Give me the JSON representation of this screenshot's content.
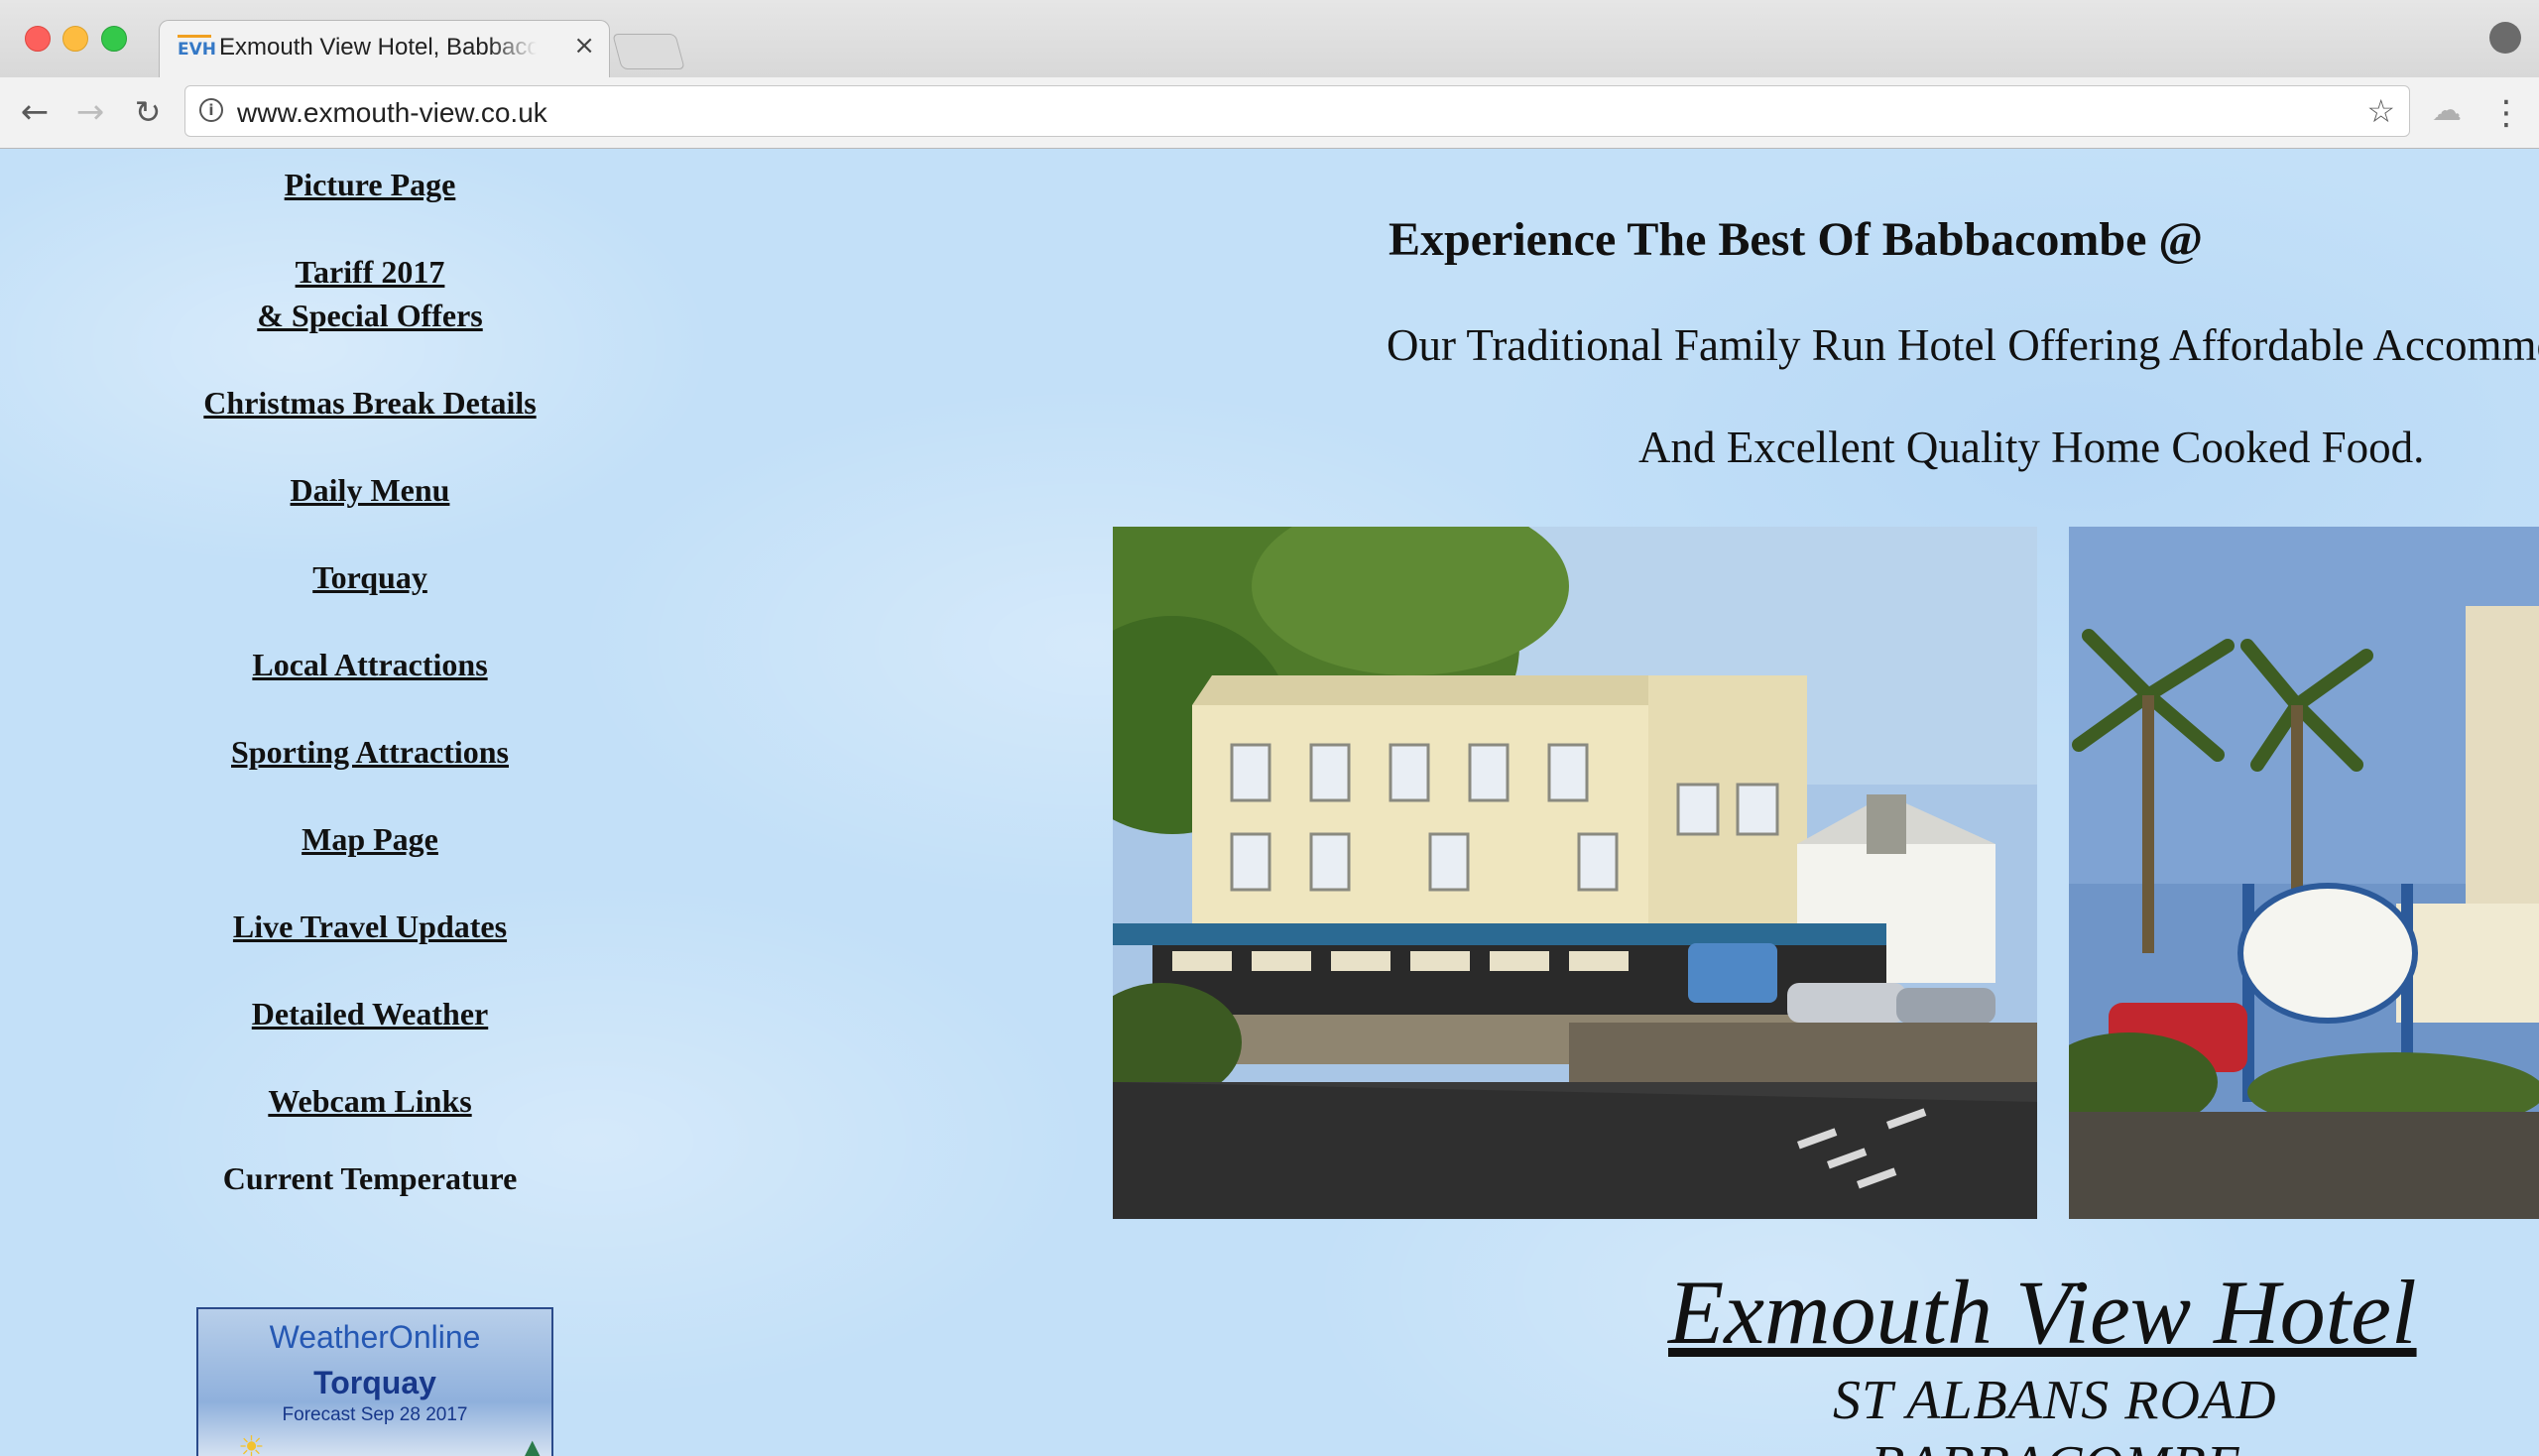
{
  "browser": {
    "tab_title": "Exmouth View Hotel, Babbacombe",
    "favicon_text": "EVH",
    "url": "www.exmouth-view.co.uk",
    "close_glyph": "×"
  },
  "sidebar": {
    "items": [
      {
        "label": "Picture Page"
      },
      {
        "label": "Tariff 2017"
      },
      {
        "label": "& Special Offers"
      },
      {
        "label": "Christmas Break Details"
      },
      {
        "label": "Daily Menu"
      },
      {
        "label": "Torquay"
      },
      {
        "label": "Local Attractions"
      },
      {
        "label": "Sporting Attractions"
      },
      {
        "label": "Map Page"
      },
      {
        "label": "Live Travel Updates"
      },
      {
        "label": "Detailed Weather"
      },
      {
        "label": "Webcam Links"
      }
    ],
    "temperature_label": "Current Temperature"
  },
  "weather_widget": {
    "brand": "WeatherOnline",
    "city": "Torquay",
    "forecast": "Forecast Sep 28 2017"
  },
  "main": {
    "headline": "Experience The Best Of Babbacombe @",
    "tagline_1": "Our Traditional Family Run Hotel Offering Affordable Accommodation",
    "tagline_2": "And Excellent Quality Home Cooked Food.",
    "hotel_name": "Exmouth View Hotel",
    "address_1": "ST ALBANS ROAD",
    "address_2": "BABBACOMBE"
  },
  "colors": {
    "page_background": "#c3e0f8",
    "link_text": "#111111",
    "widget_brand": "#2558b3"
  },
  "icons": {
    "back": "back-arrow-icon",
    "forward": "forward-arrow-icon",
    "reload": "reload-icon",
    "info": "info-icon",
    "bookmark": "star-icon",
    "menu": "kebab-menu-icon"
  }
}
